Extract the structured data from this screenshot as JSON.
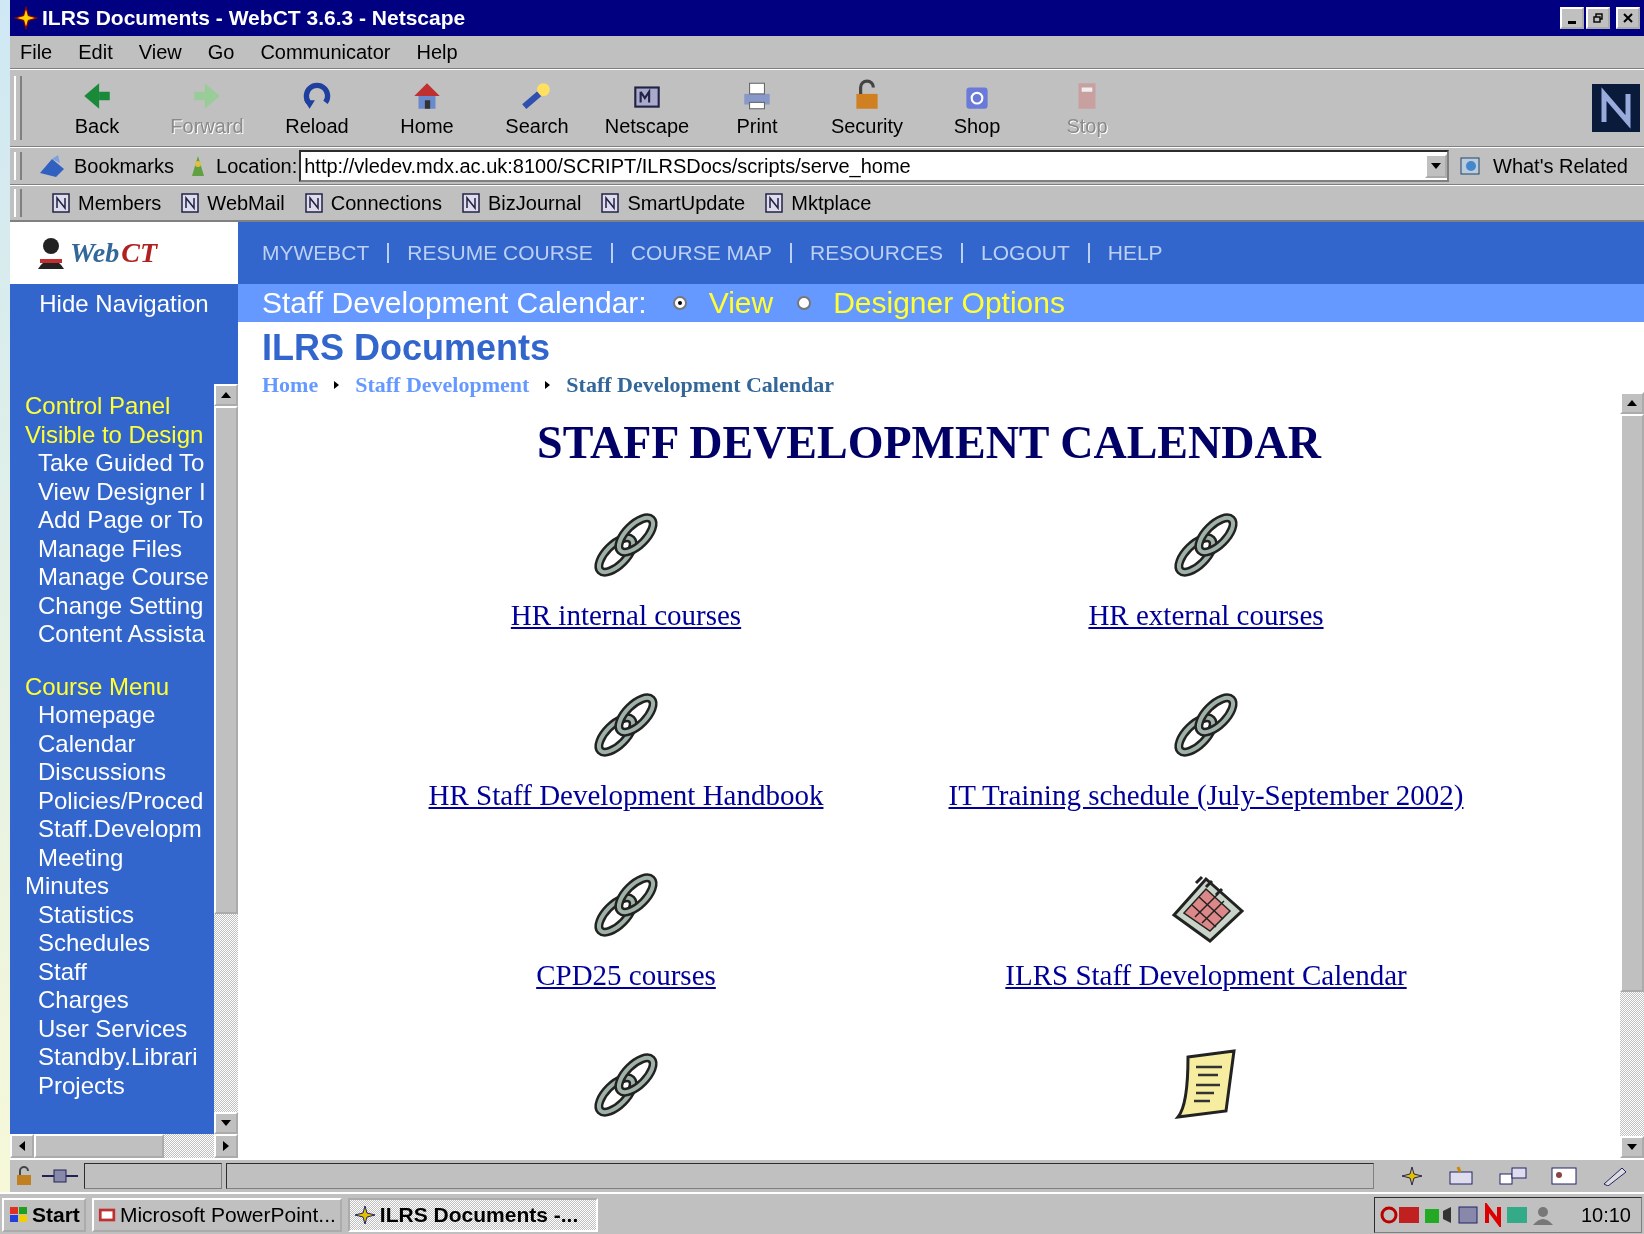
{
  "window": {
    "title": "ILRS Documents - WebCT 3.6.3 - Netscape"
  },
  "menu": [
    "File",
    "Edit",
    "View",
    "Go",
    "Communicator",
    "Help"
  ],
  "toolbar": [
    {
      "label": "Back",
      "kind": "back",
      "disabled": false
    },
    {
      "label": "Forward",
      "kind": "forward",
      "disabled": true
    },
    {
      "label": "Reload",
      "kind": "reload",
      "disabled": false
    },
    {
      "label": "Home",
      "kind": "home",
      "disabled": false
    },
    {
      "label": "Search",
      "kind": "search",
      "disabled": false
    },
    {
      "label": "Netscape",
      "kind": "netscape",
      "disabled": false
    },
    {
      "label": "Print",
      "kind": "print",
      "disabled": false
    },
    {
      "label": "Security",
      "kind": "security",
      "disabled": false
    },
    {
      "label": "Shop",
      "kind": "shop",
      "disabled": false
    },
    {
      "label": "Stop",
      "kind": "stop",
      "disabled": true
    }
  ],
  "location_bar": {
    "bookmarks": "Bookmarks",
    "label": "Location:",
    "url": "http://vledev.mdx.ac.uk:8100/SCRIPT/ILRSDocs/scripts/serve_home",
    "related": "What's Related"
  },
  "personal_toolbar": [
    "Members",
    "WebMail",
    "Connections",
    "BizJournal",
    "SmartUpdate",
    "Mktplace"
  ],
  "webct": {
    "logo_first": "Web",
    "logo_second": "CT",
    "hide_navigation": "Hide Navigation",
    "top_nav": [
      "MYWEBCT",
      "RESUME COURSE",
      "COURSE MAP",
      "RESOURCES",
      "LOGOUT",
      "HELP"
    ],
    "mode_label": "Staff Development Calendar:",
    "modes": [
      {
        "label": "View",
        "selected": true
      },
      {
        "label": "Designer Options",
        "selected": false
      }
    ],
    "page_title": "ILRS Documents",
    "breadcrumb": [
      {
        "label": "Home",
        "current": false
      },
      {
        "label": "Staff Development",
        "current": false
      },
      {
        "label": "Staff Development Calendar",
        "current": true
      }
    ]
  },
  "sidebar": [
    {
      "title": "Control Panel",
      "items": [
        {
          "label": "Visible to Design",
          "heading": true
        },
        {
          "label": "Take Guided To",
          "heading": false
        },
        {
          "label": "View Designer I",
          "heading": false
        },
        {
          "label": "Add Page or To",
          "heading": false
        },
        {
          "label": "Manage Files",
          "heading": false
        },
        {
          "label": "Manage Course",
          "heading": false
        },
        {
          "label": "Change Setting",
          "heading": false
        },
        {
          "label": "Content Assista",
          "heading": false
        }
      ]
    },
    {
      "title": "Course Menu",
      "items": [
        {
          "label": "Homepage",
          "heading": false
        },
        {
          "label": "Calendar",
          "heading": false
        },
        {
          "label": "Discussions",
          "heading": false
        },
        {
          "label": "Policies/Proced",
          "heading": false
        },
        {
          "label": "Staff.Developm",
          "heading": false
        },
        {
          "label": "Meeting",
          "heading": false
        },
        {
          "label": "Minutes",
          "heading": false,
          "flush": true
        },
        {
          "label": "Statistics",
          "heading": false
        },
        {
          "label": "Schedules",
          "heading": false
        },
        {
          "label": "Staff",
          "heading": false
        },
        {
          "label": "Charges",
          "heading": false
        },
        {
          "label": "User Services",
          "heading": false
        },
        {
          "label": "Standby.Librari",
          "heading": false
        },
        {
          "label": "Projects",
          "heading": false
        }
      ]
    }
  ],
  "content": {
    "heading": "STAFF DEVELOPMENT CALENDAR",
    "items": [
      {
        "label": "HR internal courses",
        "kind": "link"
      },
      {
        "label": "HR external courses",
        "kind": "link"
      },
      {
        "label": "HR Staff Development Handbook",
        "kind": "link"
      },
      {
        "label": "IT Training schedule (July-September 2002)",
        "kind": "link"
      },
      {
        "label": "CPD25 courses",
        "kind": "link"
      },
      {
        "label": "ILRS Staff Development Calendar",
        "kind": "calendar"
      },
      {
        "kind": "link"
      },
      {
        "kind": "note"
      }
    ]
  },
  "taskbar": {
    "start": "Start",
    "tasks": [
      {
        "label": "Microsoft PowerPoint...",
        "selected": false
      },
      {
        "label": "ILRS Documents -...",
        "selected": true
      }
    ],
    "clock": "10:10"
  }
}
